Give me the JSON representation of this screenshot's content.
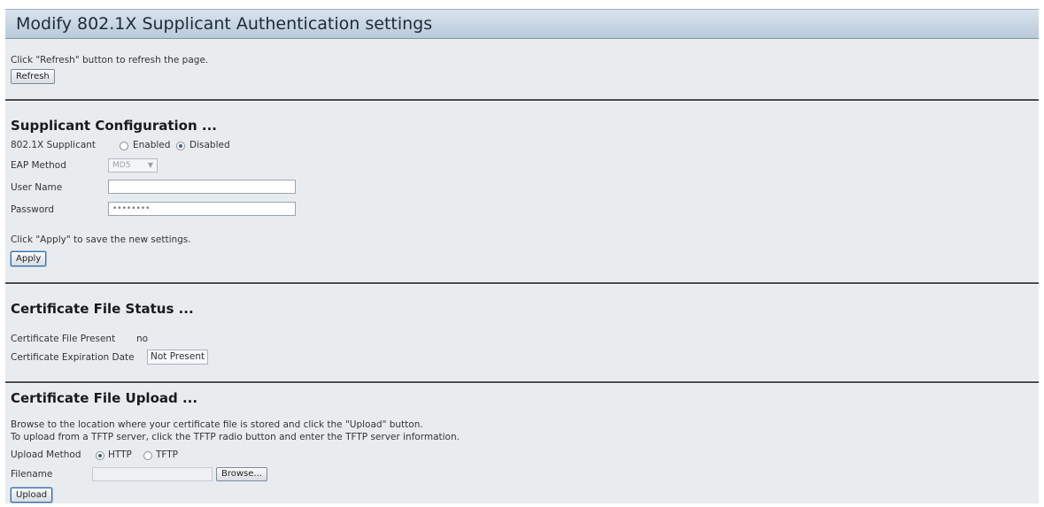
{
  "header": {
    "title": "Modify 802.1X Supplicant Authentication settings"
  },
  "refresh": {
    "hint": "Click \"Refresh\" button to refresh the page.",
    "button_label": "Refresh"
  },
  "supplicant": {
    "heading": "Supplicant Configuration ...",
    "supplicant_label": "802.1X Supplicant",
    "enabled_label": "Enabled",
    "disabled_label": "Disabled",
    "selected": "Disabled",
    "eap_label": "EAP Method",
    "eap_value": "MD5",
    "username_label": "User Name",
    "username_value": "",
    "password_label": "Password",
    "password_value": "••••••••",
    "apply_hint": "Click \"Apply\" to save the new settings.",
    "apply_label": "Apply"
  },
  "cert_status": {
    "heading": "Certificate File Status ...",
    "present_label": "Certificate File Present",
    "present_value": "no",
    "expiration_label": "Certificate Expiration Date",
    "expiration_value": "Not Present"
  },
  "cert_upload": {
    "heading": "Certificate File Upload ...",
    "hint_line1": "Browse to the location where your certificate file is stored and click the \"Upload\" button.",
    "hint_line2": "To upload from a TFTP server, click the TFTP radio button and enter the TFTP server information.",
    "method_label": "Upload Method",
    "http_label": "HTTP",
    "tftp_label": "TFTP",
    "selected": "HTTP",
    "filename_label": "Filename",
    "filename_value": "",
    "browse_label": "Browse...",
    "upload_label": "Upload"
  },
  "colors": {
    "page_bg": "#ffffff",
    "panel_bg": "#e9ecef",
    "title_bar": "#c8d6e3",
    "divider": "#4a4a4a"
  }
}
